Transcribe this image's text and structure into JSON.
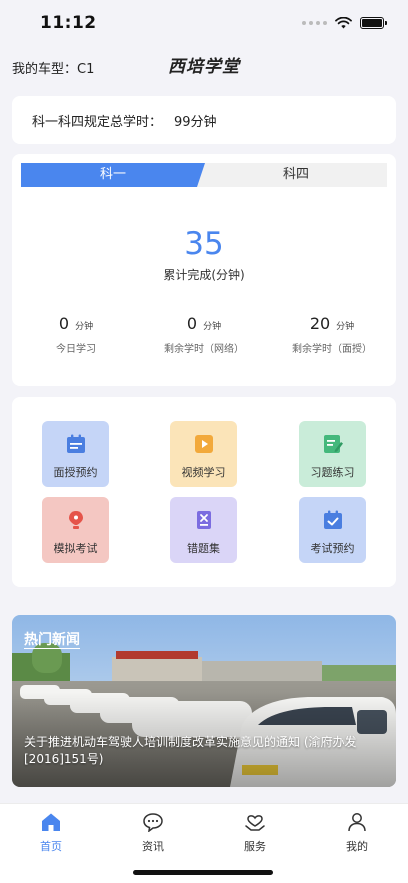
{
  "status_bar": {
    "time": "11:12"
  },
  "header": {
    "car_type": "我的车型：C1",
    "title": "西培学堂"
  },
  "hours": {
    "label": "科一科四规定总学时：",
    "value": "99分钟"
  },
  "stats": {
    "tabs": [
      {
        "label": "科一",
        "active": true
      },
      {
        "label": "科四",
        "active": false
      }
    ],
    "total_value": "35",
    "total_label": "累计完成(分钟)",
    "items": [
      {
        "value": "0",
        "unit": "分钟",
        "label": "今日学习"
      },
      {
        "value": "0",
        "unit": "分钟",
        "label": "剩余学时（网络）"
      },
      {
        "value": "20",
        "unit": "分钟",
        "label": "剩余学时（面授）"
      }
    ]
  },
  "menu": [
    {
      "label": "面授预约",
      "icon": "calendar-icon",
      "bg": "#c5d5f7",
      "fg": "#4a7ee0"
    },
    {
      "label": "视频学习",
      "icon": "video-play-icon",
      "bg": "#fbe4b8",
      "fg": "#f2a93b"
    },
    {
      "label": "习题练习",
      "icon": "exercise-edit-icon",
      "bg": "#c9ecd9",
      "fg": "#44b87c"
    },
    {
      "label": "模拟考试",
      "icon": "pen-nib-icon",
      "bg": "#f4c7c2",
      "fg": "#e5544a"
    },
    {
      "label": "错题集",
      "icon": "wrong-question-icon",
      "bg": "#dad5f7",
      "fg": "#7b6ce0"
    },
    {
      "label": "考试预约",
      "icon": "calendar-check-icon",
      "bg": "#c5d5f7",
      "fg": "#4a7ee0"
    }
  ],
  "news": {
    "title": "热门新闻",
    "text": "关于推进机动车驾驶人培训制度改革实施意见的通知 (渝府办发[2016]151号)"
  },
  "tabbar": [
    {
      "label": "首页",
      "icon": "home-icon",
      "active": true
    },
    {
      "label": "资讯",
      "icon": "chat-bubble-icon",
      "active": false
    },
    {
      "label": "服务",
      "icon": "heart-hand-icon",
      "active": false
    },
    {
      "label": "我的",
      "icon": "user-icon",
      "active": false
    }
  ],
  "colors": {
    "accent": "#4a86ee",
    "background": "#f3f3f8"
  }
}
